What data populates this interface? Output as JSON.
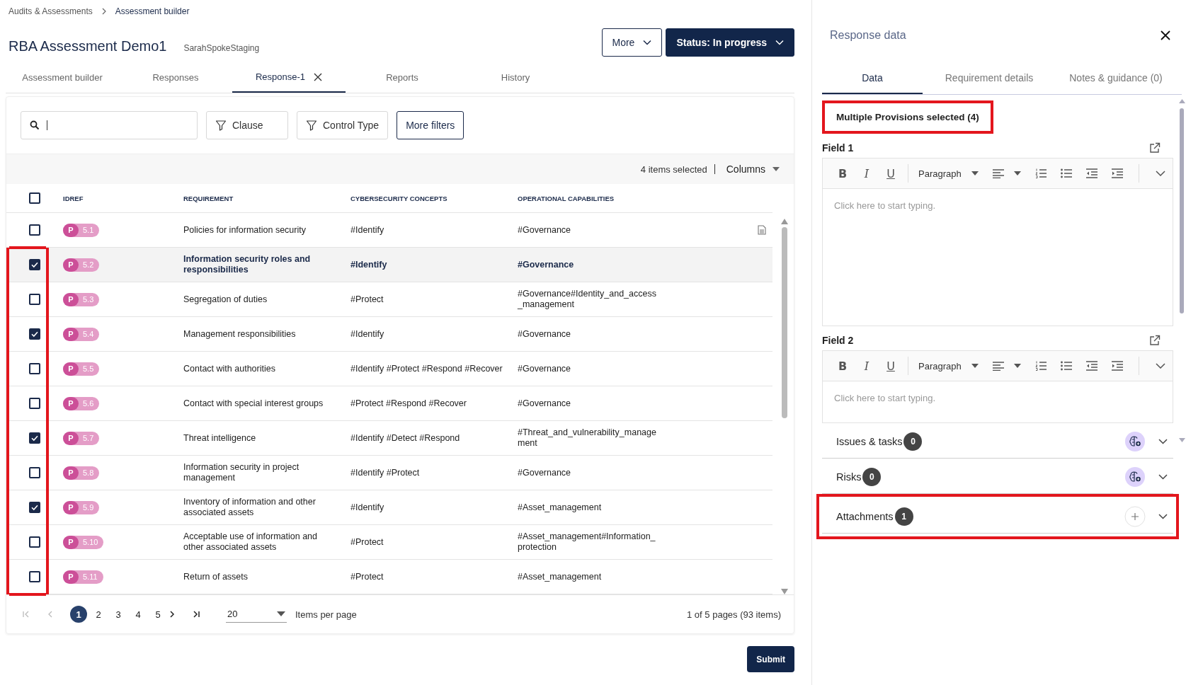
{
  "breadcrumb": [
    {
      "label": "Audits & Assessments",
      "current": false
    },
    {
      "label": "Assessment builder",
      "current": true
    }
  ],
  "title": "RBA Assessment Demo1",
  "subtitle": "SarahSpokeStaging",
  "header_buttons": [
    {
      "label": "More",
      "kind": "outline"
    },
    {
      "label": "Status: In progress",
      "kind": "primary"
    }
  ],
  "tabs": [
    {
      "label": "Assessment builder",
      "selected": false,
      "closable": false
    },
    {
      "label": "Responses",
      "selected": false,
      "closable": false
    },
    {
      "label": "Response-1",
      "selected": true,
      "closable": true
    },
    {
      "label": "Reports",
      "selected": false,
      "closable": false
    },
    {
      "label": "History",
      "selected": false,
      "closable": false
    }
  ],
  "filter_buttons": [
    {
      "label": "Clause",
      "kind": "filter"
    },
    {
      "label": "Control Type",
      "kind": "filter"
    },
    {
      "label": "More filters",
      "kind": "plain"
    }
  ],
  "selection_summary": "4 items selected",
  "columns_menu": "Columns",
  "table": {
    "columns": [
      "IDREF",
      "REQUIREMENT",
      "CYBERSECURITY CONCEPTS",
      "OPERATIONAL CAPABILITIES"
    ],
    "all_checked": false,
    "rows": [
      {
        "type": "P",
        "id": "5.1",
        "requirement": "Policies for information security",
        "concepts": "#Identify",
        "capabilities": "#Governance",
        "checked": false,
        "selected": false,
        "has_document": true,
        "highlighted": false
      },
      {
        "type": "P",
        "id": "5.2",
        "requirement": "Information security roles and responsibilities",
        "concepts": "#Identify",
        "capabilities": "#Governance",
        "checked": true,
        "selected": true,
        "has_document": false,
        "highlighted": true
      },
      {
        "type": "P",
        "id": "5.3",
        "requirement": "Segregation of duties",
        "concepts": "#Protect",
        "capabilities": "#Governance#Identity_and_access_management",
        "checked": false,
        "selected": false,
        "has_document": false,
        "highlighted": true
      },
      {
        "type": "P",
        "id": "5.4",
        "requirement": "Management responsibilities",
        "concepts": "#Identify",
        "capabilities": "#Governance",
        "checked": true,
        "selected": false,
        "has_document": false,
        "highlighted": true
      },
      {
        "type": "P",
        "id": "5.5",
        "requirement": "Contact with authorities",
        "concepts": "#Identify #Protect #Respond #Recover",
        "capabilities": "#Governance",
        "checked": false,
        "selected": false,
        "has_document": false,
        "highlighted": true
      },
      {
        "type": "P",
        "id": "5.6",
        "requirement": "Contact with special interest groups",
        "concepts": "#Protect #Respond #Recover",
        "capabilities": "#Governance",
        "checked": false,
        "selected": false,
        "has_document": false,
        "highlighted": true
      },
      {
        "type": "P",
        "id": "5.7",
        "requirement": "Threat intelligence",
        "concepts": "#Identify #Detect #Respond",
        "capabilities": "#Threat_and_vulnerability_management",
        "checked": true,
        "selected": false,
        "has_document": false,
        "highlighted": true
      },
      {
        "type": "P",
        "id": "5.8",
        "requirement": "Information security in project management",
        "concepts": "#Identify #Protect",
        "capabilities": "#Governance",
        "checked": false,
        "selected": false,
        "has_document": false,
        "highlighted": true
      },
      {
        "type": "P",
        "id": "5.9",
        "requirement": "Inventory of information and other associated assets",
        "concepts": "#Identify",
        "capabilities": "#Asset_management",
        "checked": true,
        "selected": false,
        "has_document": false,
        "highlighted": true
      },
      {
        "type": "P",
        "id": "5.10",
        "requirement": "Acceptable use of information and other associated assets",
        "concepts": "#Protect",
        "capabilities": "#Asset_management#Information_protection",
        "checked": false,
        "selected": false,
        "has_document": false,
        "highlighted": true
      },
      {
        "type": "P",
        "id": "5.11",
        "requirement": "Return of assets",
        "concepts": "#Protect",
        "capabilities": "#Asset_management",
        "checked": false,
        "selected": false,
        "has_document": false,
        "highlighted": true
      }
    ]
  },
  "pagination": {
    "pages": [
      {
        "label": "1",
        "selected": true
      },
      {
        "label": "2",
        "selected": false
      },
      {
        "label": "3",
        "selected": false
      },
      {
        "label": "4",
        "selected": false
      },
      {
        "label": "5",
        "selected": false
      }
    ],
    "per_page": "20",
    "per_page_label": "Items per page",
    "summary": "1 of 5 pages (93 items)"
  },
  "submit": "Submit",
  "panel": {
    "title": "Response data",
    "tabs": [
      {
        "label": "Data",
        "selected": true
      },
      {
        "label": "Requirement details",
        "selected": false
      },
      {
        "label": "Notes & guidance (0)",
        "selected": false
      }
    ],
    "banner": {
      "text": "Multiple Provisions selected (4)",
      "highlighted": true
    },
    "fields": [
      {
        "label": "Field 1",
        "format_buttons": [
          {
            "label": "B",
            "kind": "bold"
          },
          {
            "label": "I",
            "kind": "italic"
          },
          {
            "label": "U",
            "kind": "underline"
          }
        ],
        "block_style": "Paragraph",
        "placeholder": "Click here to start typing.",
        "kind": "tall"
      },
      {
        "label": "Field 2",
        "format_buttons": [
          {
            "label": "B",
            "kind": "bold"
          },
          {
            "label": "I",
            "kind": "italic"
          },
          {
            "label": "U",
            "kind": "underline"
          }
        ],
        "block_style": "Paragraph",
        "placeholder": "Click here to start typing.",
        "kind": "short"
      }
    ],
    "sections": [
      {
        "label": "Issues & tasks",
        "count": "0",
        "kind": "ai",
        "highlighted": false
      },
      {
        "label": "Risks",
        "count": "0",
        "kind": "ai",
        "highlighted": false
      },
      {
        "label": "Attachments",
        "count": "1",
        "kind": "add",
        "highlighted": true
      }
    ]
  }
}
